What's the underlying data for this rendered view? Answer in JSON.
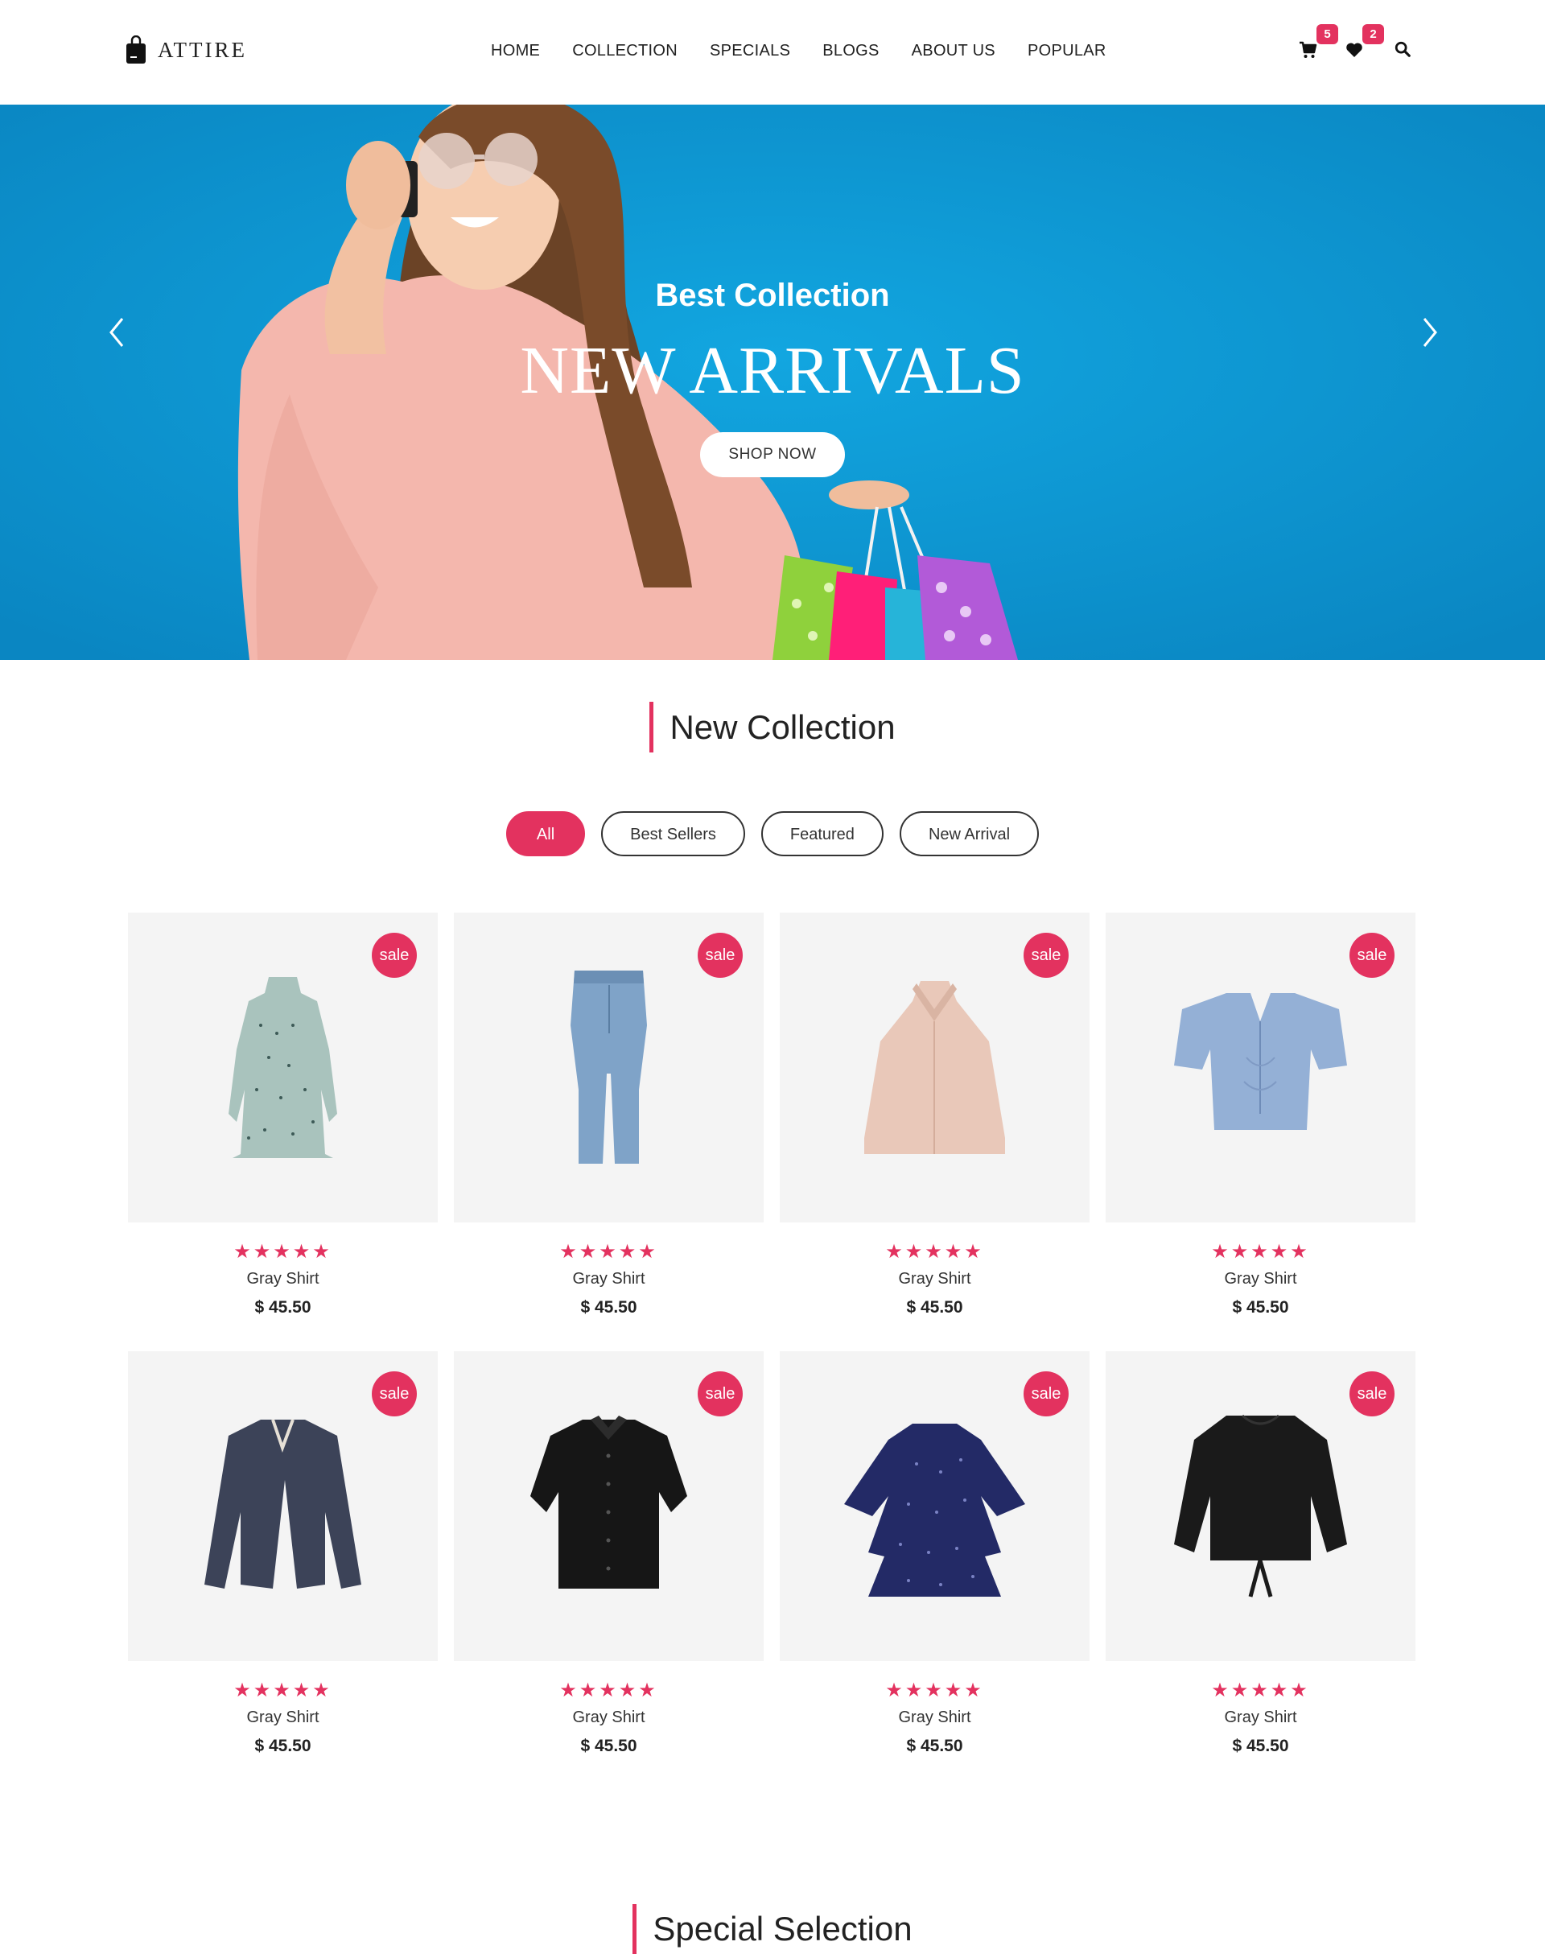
{
  "brand": {
    "name": "ATTIRE"
  },
  "nav": [
    "HOME",
    "COLLECTION",
    "SPECIALS",
    "BLOGS",
    "ABOUT US",
    "POPULAR"
  ],
  "header_icons": {
    "cart_count": "5",
    "wishlist_count": "2"
  },
  "hero": {
    "subtitle": "Best Collection",
    "title": "NEW ARRIVALS",
    "button": "SHOP NOW"
  },
  "new_collection": {
    "title": "New Collection",
    "filters": [
      "All",
      "Best Sellers",
      "Featured",
      "New Arrival"
    ],
    "active_filter": "All",
    "products": [
      {
        "name": "Gray Shirt",
        "price": "$ 45.50",
        "badge": "sale",
        "rating": 5,
        "stars": "★★★★★",
        "item": "dotted-dress"
      },
      {
        "name": "Gray Shirt",
        "price": "$ 45.50",
        "badge": "sale",
        "rating": 5,
        "stars": "★★★★★",
        "item": "jeans"
      },
      {
        "name": "Gray Shirt",
        "price": "$ 45.50",
        "badge": "sale",
        "rating": 5,
        "stars": "★★★★★",
        "item": "halter-top"
      },
      {
        "name": "Gray Shirt",
        "price": "$ 45.50",
        "badge": "sale",
        "rating": 5,
        "stars": "★★★★★",
        "item": "blue-crop-top"
      },
      {
        "name": "Gray Shirt",
        "price": "$ 45.50",
        "badge": "sale",
        "rating": 5,
        "stars": "★★★★★",
        "item": "navy-jacket"
      },
      {
        "name": "Gray Shirt",
        "price": "$ 45.50",
        "badge": "sale",
        "rating": 5,
        "stars": "★★★★★",
        "item": "black-shirt"
      },
      {
        "name": "Gray Shirt",
        "price": "$ 45.50",
        "badge": "sale",
        "rating": 5,
        "stars": "★★★★★",
        "item": "navy-ruffle-blouse"
      },
      {
        "name": "Gray Shirt",
        "price": "$ 45.50",
        "badge": "sale",
        "rating": 5,
        "stars": "★★★★★",
        "item": "black-blouse"
      }
    ]
  },
  "special_selection": {
    "title": "Special Selection"
  },
  "colors": {
    "accent": "#e3325f",
    "hero_bg": "#0a9ad6",
    "card_bg": "#f4f4f4"
  }
}
